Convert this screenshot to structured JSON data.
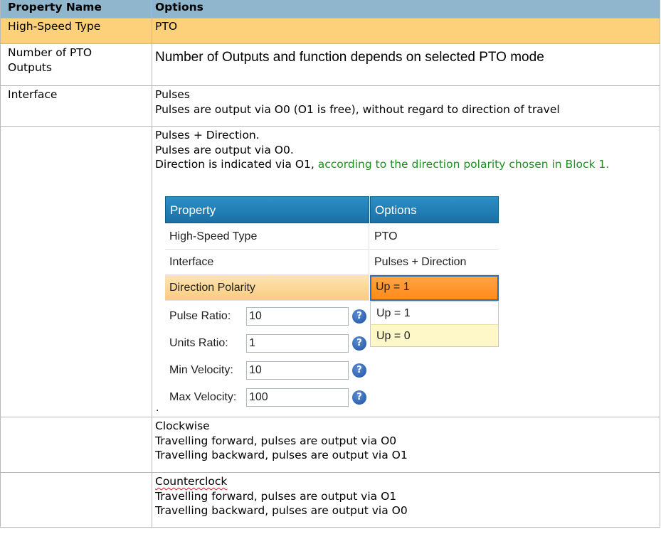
{
  "header": {
    "col1": "Property Name",
    "col2": "Options"
  },
  "rows": {
    "high_speed": {
      "label": "High-Speed Type",
      "value": "PTO"
    },
    "num_outputs": {
      "label": "Number of PTO\nOutputs",
      "value": "Number of Outputs and function depends on selected PTO mode"
    },
    "interface": {
      "label": "Interface",
      "value": "Pulses\nPulses are output via O0 (O1 is free), without regard to direction of travel"
    },
    "pulses_direction": {
      "line1": "Pulses + Direction.",
      "line2": "Pulses are output via O0.",
      "line3_prefix": "Direction is indicated via O1, ",
      "line3_green": "according to the direction polarity chosen in Block 1.",
      "bullet": "."
    },
    "clockwise": {
      "value": "Clockwise\nTravelling forward, pulses are output via O0\nTravelling backward, pulses are output via O1"
    },
    "counterclock": {
      "title": "Counterclock",
      "lines": "Travelling forward, pulses are output via O1\nTravelling backward, pulses are output via O0"
    }
  },
  "screenshot": {
    "header_property": "Property",
    "header_options": "Options",
    "rows": [
      {
        "label": "High-Speed Type",
        "value": "PTO"
      },
      {
        "label": "Interface",
        "value": "Pulses + Direction"
      },
      {
        "label": "Direction Polarity",
        "value": "Up = 1"
      }
    ],
    "dropdown": [
      "Up = 1",
      "Up = 0"
    ],
    "fields": [
      {
        "label": "Pulse Ratio:",
        "value": "10"
      },
      {
        "label": "Units Ratio:",
        "value": "1"
      },
      {
        "label": "Min Velocity:",
        "value": "10"
      },
      {
        "label": "Max Velocity:",
        "value": "100"
      }
    ],
    "help_glyph": "?"
  },
  "colors": {
    "header_bg": "#90b6ce",
    "highlight_row": "#fdd17a",
    "green_text": "#1f8f1f"
  }
}
